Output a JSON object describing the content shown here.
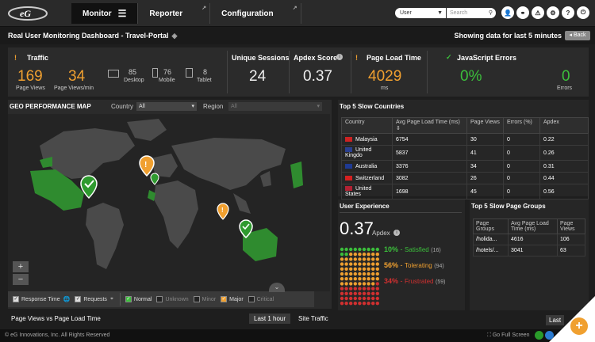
{
  "header": {
    "nav": [
      {
        "label": "Monitor"
      },
      {
        "label": "Reporter"
      },
      {
        "label": "Configuration"
      }
    ],
    "user_select": "User",
    "search_placeholder": "Search",
    "icons": [
      "user-icon",
      "link-icon",
      "alerts-icon",
      "settings-icon",
      "help-icon",
      "power-icon"
    ]
  },
  "titlebar": {
    "title": "Real User Monitoring Dashboard - Travel-Portal",
    "showing": "Showing data for last 5 minutes",
    "back": "Back"
  },
  "kpi": {
    "traffic": {
      "label": "Traffic",
      "page_views": "169",
      "page_views_label": "Page Views",
      "ppm": "34",
      "ppm_label": "Page Views/min",
      "desktop": "85",
      "desktop_label": "Desktop",
      "mobile": "76",
      "mobile_label": "Mobile",
      "tablet": "8",
      "tablet_label": "Tablet"
    },
    "sessions": {
      "label": "Unique Sessions",
      "value": "24"
    },
    "apdex": {
      "label": "Apdex Score",
      "value": "0.37"
    },
    "load_time": {
      "label": "Page Load Time",
      "value": "4029",
      "unit": "ms"
    },
    "js_errors": {
      "label": "JavaScript Errors",
      "percent": "0%",
      "errors": "0",
      "errors_label": "Errors"
    }
  },
  "map": {
    "title": "GEO PERFORMANCE MAP",
    "country_label": "Country",
    "country_value": "All",
    "region_label": "Region",
    "region_value": "All",
    "legend": {
      "response_time": "Response Time",
      "requests": "Requests",
      "normal": "Normal",
      "unknown": "Unknown",
      "minor": "Minor",
      "major": "Major",
      "critical": "Critical"
    }
  },
  "countries": {
    "title": "Top 5 Slow Countries",
    "headers": [
      "Country",
      "Avg Page Load Time (ms)",
      "Page Views",
      "Errors (%)",
      "Apdex"
    ],
    "rows": [
      {
        "country": "Malaysia",
        "load": "6754",
        "views": "30",
        "errors": "0",
        "apdex": "0.22",
        "flag": "#cc2222"
      },
      {
        "country": "United Kingdo",
        "load": "5837",
        "views": "41",
        "errors": "0",
        "apdex": "0.26",
        "flag": "#2a3f8f"
      },
      {
        "country": "Australia",
        "load": "3376",
        "views": "34",
        "errors": "0",
        "apdex": "0.31",
        "flag": "#1f3a93"
      },
      {
        "country": "Switzerland",
        "load": "3082",
        "views": "26",
        "errors": "0",
        "apdex": "0.44",
        "flag": "#d42020"
      },
      {
        "country": "United States",
        "load": "1698",
        "views": "45",
        "errors": "0",
        "apdex": "0.56",
        "flag": "#b22234"
      }
    ]
  },
  "ux": {
    "title": "User Experience",
    "apdex": "0.37",
    "apdex_label": "Apdex",
    "satisfied_pct": "10%",
    "satisfied_label": "Satisfied",
    "satisfied_cnt": "(16)",
    "tolerating_pct": "56%",
    "tolerating_label": "Tolerating",
    "tolerating_cnt": "(94)",
    "frustrated_pct": "34%",
    "frustrated_label": "Frustrated",
    "frustrated_cnt": "(59)"
  },
  "groups": {
    "title": "Top 5 Slow Page Groups",
    "headers": [
      "Page Groups",
      "Avg Page Load Time (ms)",
      "Page Views"
    ],
    "rows": [
      {
        "group": "/holida...",
        "load": "4616",
        "views": "106"
      },
      {
        "group": "/hotels/...",
        "load": "3041",
        "views": "63"
      }
    ]
  },
  "bottom": {
    "pv_title": "Page Views vs Page Load Time",
    "last_hour": "Last 1 hour",
    "site_traffic": "Site Traffic",
    "last": "Last"
  },
  "footer": {
    "copyright": "© eG Innovations, Inc. All Rights Reserved",
    "full_screen": "Go Full Screen"
  }
}
